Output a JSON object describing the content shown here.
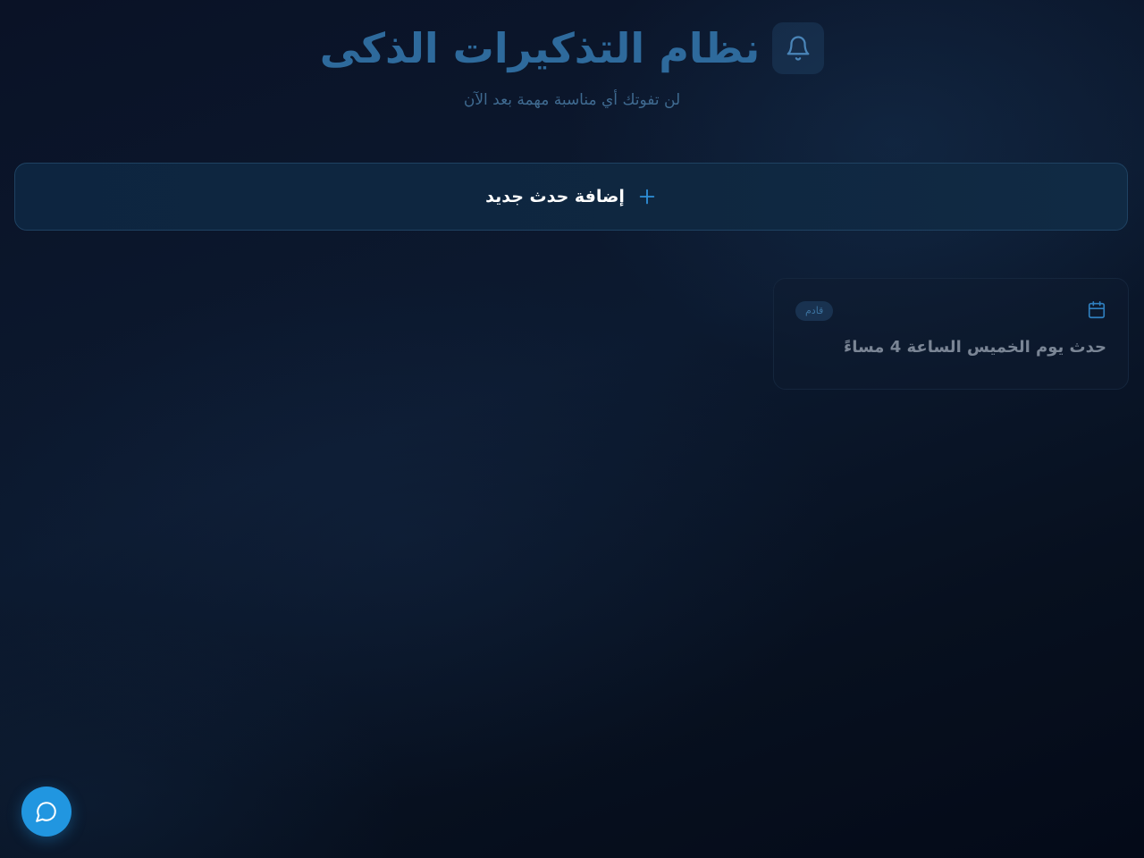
{
  "header": {
    "title": "نظام التذكيرات الذكى",
    "subtitle": "لن تفوتك أي مناسبة مهمة بعد الآن",
    "icon": "bell-icon"
  },
  "actions": {
    "add_event_label": "إضافة حدث جديد",
    "add_icon": "plus-icon"
  },
  "events": [
    {
      "title": "حدث يوم الخميس الساعة 4 مساءً",
      "status": "قادم",
      "icon": "calendar-icon"
    }
  ],
  "chat": {
    "icon": "chat-bubble-icon"
  },
  "colors": {
    "accent": "#2196e0",
    "title": "#2e6a9c",
    "background": "#0a1226"
  }
}
